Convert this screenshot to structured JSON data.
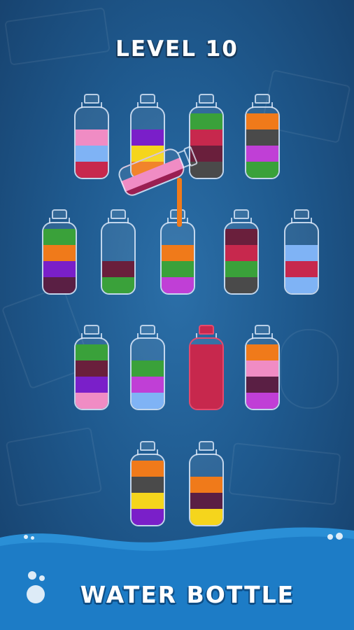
{
  "header": {
    "level_label": "LEVEL 10"
  },
  "footer": {
    "title": "WATER BOTTLE"
  },
  "colors": {
    "pink": "#f08cc4",
    "light_blue": "#7fb3f5",
    "crimson": "#c7284d",
    "purple": "#7a1fc9",
    "yellow": "#f5d51c",
    "orange": "#f07a1a",
    "green": "#3aa13a",
    "maroon": "#6a1f3c",
    "dark_gray": "#4a4a4a",
    "magenta": "#c03fd6",
    "plum": "#5a1f44"
  },
  "bottles": [
    {
      "layers_bottom_to_top": [
        "crimson",
        "light_blue",
        "pink"
      ]
    },
    {
      "layers_bottom_to_top": [
        "orange",
        "yellow",
        "purple"
      ]
    },
    {
      "layers_bottom_to_top": [
        "dark_gray",
        "maroon",
        "crimson",
        "green"
      ]
    },
    {
      "layers_bottom_to_top": [
        "green",
        "magenta",
        "dark_gray",
        "orange"
      ]
    },
    {
      "layers_bottom_to_top": [
        "plum",
        "purple",
        "orange",
        "green"
      ]
    },
    {
      "layers_bottom_to_top": [
        "green",
        "maroon"
      ]
    },
    {
      "layers_bottom_to_top": [
        "magenta",
        "green",
        "orange"
      ]
    },
    {
      "layers_bottom_to_top": [
        "dark_gray",
        "green",
        "crimson",
        "maroon"
      ]
    },
    {
      "layers_bottom_to_top": [
        "light_blue",
        "crimson",
        "light_blue"
      ]
    },
    {
      "layers_bottom_to_top": [
        "pink",
        "purple",
        "maroon",
        "green"
      ]
    },
    {
      "layers_bottom_to_top": [
        "light_blue",
        "magenta",
        "green"
      ]
    },
    {
      "layers_bottom_to_top": [
        "crimson",
        "crimson",
        "crimson",
        "crimson"
      ],
      "sealed": true
    },
    {
      "layers_bottom_to_top": [
        "magenta",
        "plum",
        "pink",
        "orange"
      ]
    },
    {
      "layers_bottom_to_top": [
        "purple",
        "yellow",
        "dark_gray",
        "orange"
      ]
    },
    {
      "layers_bottom_to_top": [
        "yellow",
        "plum",
        "orange"
      ]
    }
  ],
  "pouring_bottle": {
    "layers_bottom_to_top": [
      "maroon",
      "pink"
    ],
    "stream_color": "orange"
  }
}
